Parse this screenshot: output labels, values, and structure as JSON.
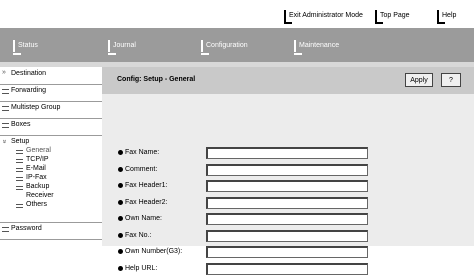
{
  "top_links": [
    "Exit Administrator Mode",
    "Top Page",
    "Help"
  ],
  "nav_tabs": [
    "Status",
    "Journal",
    "Configuration",
    "Maintenance"
  ],
  "sidebar": {
    "items": [
      {
        "label": "Destination",
        "icon": "double-arrow-icon"
      },
      {
        "label": "Forwarding",
        "icon": "menu-item-icon"
      },
      {
        "label": "Multistep Group",
        "icon": "menu-item-icon"
      },
      {
        "label": "Boxes",
        "icon": "menu-item-icon"
      },
      {
        "label": "Setup",
        "icon": "double-arrow-down-icon"
      },
      {
        "label": "Password",
        "icon": "menu-item-icon"
      }
    ],
    "setup_subitems": [
      "General",
      "TCP/IP",
      "E-Mail",
      "IP-Fax",
      "Backup Receiver",
      "Others"
    ],
    "backup_line1": "Backup",
    "backup_line2": "Receiver",
    "active_subitem": "General"
  },
  "content": {
    "title": "Config: Setup - General",
    "apply_label": "Apply",
    "help_label": "?",
    "fields": [
      {
        "label": "Fax Name:",
        "value": ""
      },
      {
        "label": "Comment:",
        "value": ""
      },
      {
        "label": "Fax Header1:",
        "value": ""
      },
      {
        "label": "Fax Header2:",
        "value": ""
      },
      {
        "label": "Own Name:",
        "value": ""
      },
      {
        "label": "Fax No.:",
        "value": ""
      },
      {
        "label": "Own Number(G3):",
        "value": ""
      },
      {
        "label": "Help URL:",
        "value": ""
      }
    ]
  }
}
